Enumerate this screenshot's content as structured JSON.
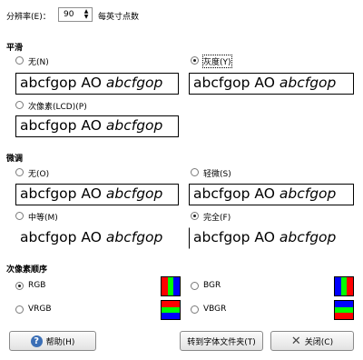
{
  "resolution": {
    "label": "分辨率(E)：",
    "value": "90",
    "unit": "每英寸点数"
  },
  "smoothing": {
    "title": "平滑",
    "options": [
      {
        "label": "无(N)",
        "selected": false
      },
      {
        "label": "灰度(Y)",
        "selected": true
      },
      {
        "label": "次像素(LCD)(P)",
        "selected": false
      }
    ]
  },
  "hinting": {
    "title": "微调",
    "options": [
      {
        "label": "无(O)",
        "selected": false
      },
      {
        "label": "轻微(S)",
        "selected": false
      },
      {
        "label": "中等(M)",
        "selected": false
      },
      {
        "label": "完全(F)",
        "selected": true
      }
    ]
  },
  "sample": {
    "regular": "abcfgop AO ",
    "italic": "abcfgop"
  },
  "subpixel": {
    "title": "次像素顺序",
    "options": [
      {
        "label": "RGB",
        "selected": true,
        "colors": [
          "#ff0000",
          "#00ff00",
          "#0000ff"
        ]
      },
      {
        "label": "BGR",
        "selected": false,
        "colors": [
          "#0000ff",
          "#00ff00",
          "#ff0000"
        ]
      },
      {
        "label": "VRGB",
        "selected": false,
        "colors": [
          "#ff0000",
          "#00ff00",
          "#0000ff"
        ]
      },
      {
        "label": "VBGR",
        "selected": false,
        "colors": [
          "#0000ff",
          "#00ff00",
          "#ff0000"
        ]
      }
    ]
  },
  "buttons": {
    "help": "帮助(H)",
    "goto_folder": "转到字体文件夹(T)",
    "close": "关闭(C)"
  }
}
